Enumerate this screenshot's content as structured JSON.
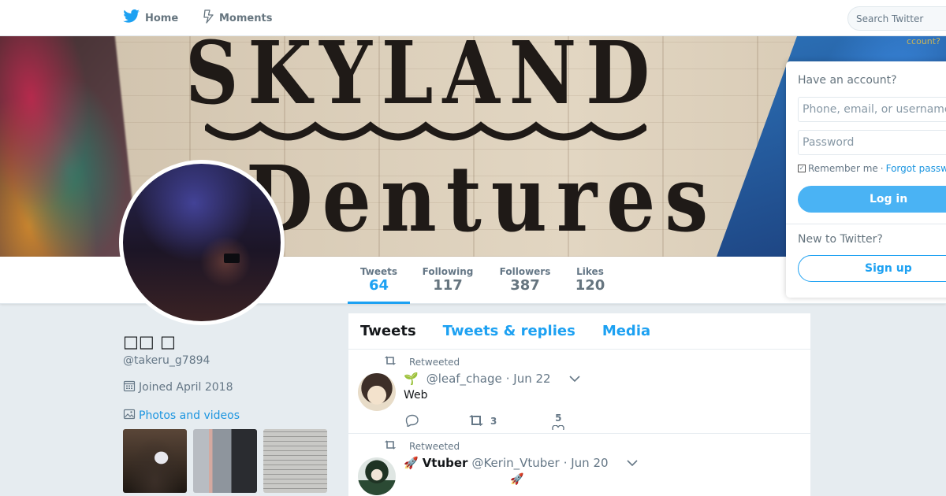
{
  "topnav": {
    "home_label": "Home",
    "moments_label": "Moments",
    "search_placeholder": "Search Twitter"
  },
  "banner": {
    "sign_line_1": "SKYLAND",
    "sign_line_2": "Dentures",
    "peek_text": "ccount?"
  },
  "stats": [
    {
      "label": "Tweets",
      "value": "64"
    },
    {
      "label": "Following",
      "value": "117"
    },
    {
      "label": "Followers",
      "value": "387"
    },
    {
      "label": "Likes",
      "value": "120"
    }
  ],
  "profile": {
    "name": "□□ □",
    "handle": "@takeru_g7894",
    "joined": "Joined April 2018",
    "photos_label": "Photos and videos"
  },
  "timeline": {
    "tabs": [
      {
        "label": "Tweets"
      },
      {
        "label": "Tweets & replies"
      },
      {
        "label": "Media"
      }
    ],
    "tweets": [
      {
        "retweeted_label": "Retweeted",
        "name_prefix": "🌱",
        "fullname": "",
        "handle": "@leaf_chage",
        "date": "· Jun 22",
        "text": "Web",
        "retweets": "3",
        "likes": "5"
      },
      {
        "retweeted_label": "Retweeted",
        "name_prefix": "🚀",
        "fullname": "Vtuber",
        "handle": "@Kerin_Vtuber",
        "date": "· Jun 20",
        "text": "🚀"
      }
    ]
  },
  "login": {
    "title": "Have an account?",
    "phone_placeholder": "Phone, email, or username",
    "password_placeholder": "Password",
    "remember_label": "Remember me",
    "separator": "·",
    "forgot_label": "Forgot password?",
    "login_button": "Log in",
    "new_to_label": "New to Twitter?",
    "signup_button": "Sign up"
  },
  "colors": {
    "accent": "#1da1f2",
    "background": "#e6ecf0",
    "login_button_bg": "#4ab3f4"
  }
}
